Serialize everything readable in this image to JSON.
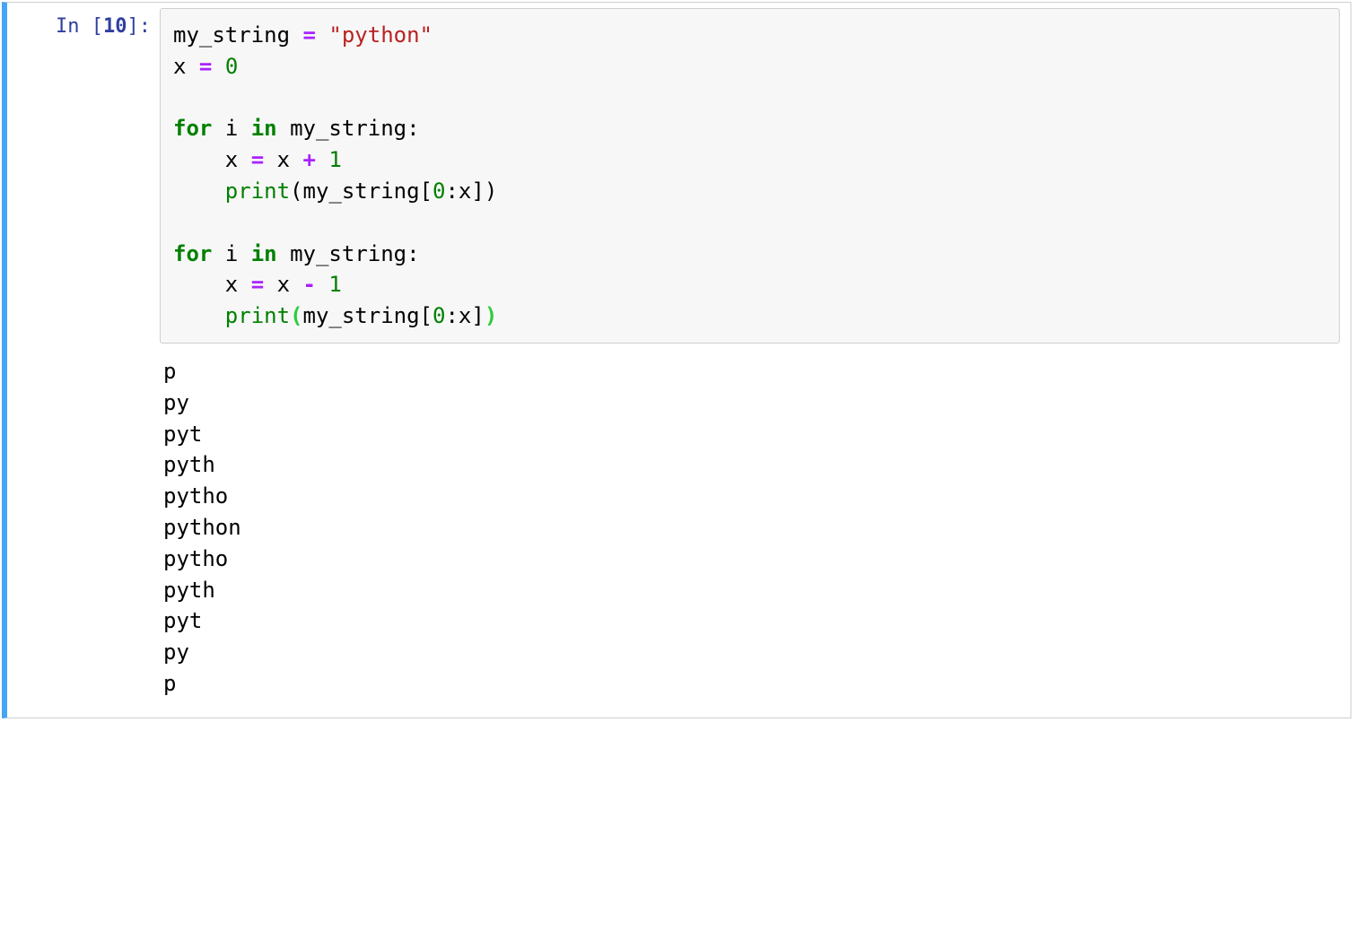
{
  "cell": {
    "prompt": {
      "label": "In ",
      "open_bracket": "[",
      "exec_count": "10",
      "close_bracket": "]:"
    },
    "code": {
      "l1_var": "my_string",
      "l1_eq": " = ",
      "l1_str": "\"python\"",
      "l2_var": "x",
      "l2_eq": " = ",
      "l2_num": "0",
      "blank1": "",
      "l4_for": "for",
      "l4_sp1": " ",
      "l4_i": "i",
      "l4_sp2": " ",
      "l4_in": "in",
      "l4_sp3": " ",
      "l4_iter": "my_string",
      "l4_colon": ":",
      "l5_indent": "    ",
      "l5_var": "x",
      "l5_eq": " = ",
      "l5_rhs_x": "x",
      "l5_sp": " ",
      "l5_op": "+",
      "l5_sp2": " ",
      "l5_num": "1",
      "l6_indent": "    ",
      "l6_print": "print",
      "l6_open": "(",
      "l6_arg": "my_string",
      "l6_slice": "[",
      "l6_slice_a": "0",
      "l6_slice_c": ":",
      "l6_slice_b": "x",
      "l6_slice_close": "]",
      "l6_close": ")",
      "blank2": "",
      "l8_for": "for",
      "l8_sp1": " ",
      "l8_i": "i",
      "l8_sp2": " ",
      "l8_in": "in",
      "l8_sp3": " ",
      "l8_iter": "my_string",
      "l8_colon": ":",
      "l9_indent": "    ",
      "l9_var": "x",
      "l9_eq": " = ",
      "l9_rhs_x": "x",
      "l9_sp": " ",
      "l9_op": "-",
      "l9_sp2": " ",
      "l9_num": "1",
      "l10_indent": "    ",
      "l10_print": "print",
      "l10_open": "(",
      "l10_arg": "my_string",
      "l10_slice": "[",
      "l10_slice_a": "0",
      "l10_slice_c": ":",
      "l10_slice_b": "x",
      "l10_slice_close": "]",
      "l10_close": ")"
    },
    "output_lines": [
      "p",
      "py",
      "pyt",
      "pyth",
      "pytho",
      "python",
      "pytho",
      "pyth",
      "pyt",
      "py",
      "p",
      ""
    ]
  }
}
